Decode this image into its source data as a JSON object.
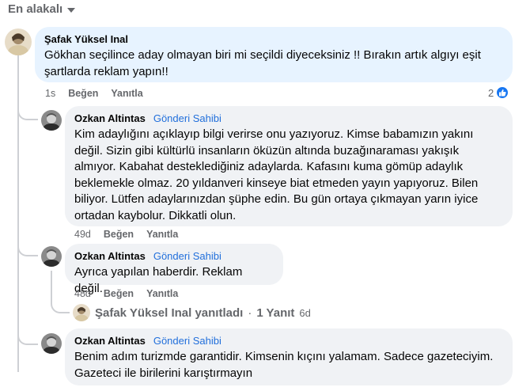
{
  "sort": {
    "label": "En alakalı"
  },
  "comments": [
    {
      "author": "Şafak Yüksel Inal",
      "text": "Gökhan seçilince aday olmayan biri mi seçildi diyeceksiniz !! Bırakın artık algıyı eşit şartlarda reklam yapın!!",
      "age": "1s",
      "like": "Beğen",
      "reply": "Yanıtla",
      "reaction_count": "2"
    },
    {
      "author": "Ozkan Altintas",
      "badge": "Gönderi Sahibi",
      "text": "Kim adaylığını açıklayıp bilgi verirse onu yazıyoruz. Kimse babamızın yakını değil. Sizin gibi kültürlü insanların öküzün altında buzağınaraması yakışık almıyor. Kabahat desteklediğiniz adaylarda. Kafasını kuma gömüp adaylık beklemekle olmaz. 20 yıldanveri kinseye biat etmeden yayın yapıyoruz. Bilen biliyor. Lütfen adaylarınızdan şüphe edin. Bu gün ortaya çıkmayan yarın iyice ortadan kaybolur. Dikkatli olun.",
      "age": "49d",
      "like": "Beğen",
      "reply": "Yanıtla"
    },
    {
      "author": "Ozkan Altintas",
      "badge": "Gönderi Sahibi",
      "text": "Ayrıca yapılan haberdir. Reklam değil.",
      "age": "48d",
      "like": "Beğen",
      "reply": "Yanıtla",
      "replies_link": {
        "name": "Şafak Yüksel Inal yanıtladı",
        "sep": "·",
        "count": "1 Yanıt",
        "age": "6d"
      }
    },
    {
      "author": "Ozkan Altintas",
      "badge": "Gönderi Sahibi",
      "text": "Benim adım turizmde garantidir. Kimsenin kıçını yalamam. Sadece gazeteciyim. Gazeteci ile birilerini karıştırmayın"
    }
  ],
  "colors": {
    "bubble": "#f0f2f5",
    "highlight": "#e7f3ff",
    "badge": "#216fdb",
    "meta": "#65676b"
  }
}
